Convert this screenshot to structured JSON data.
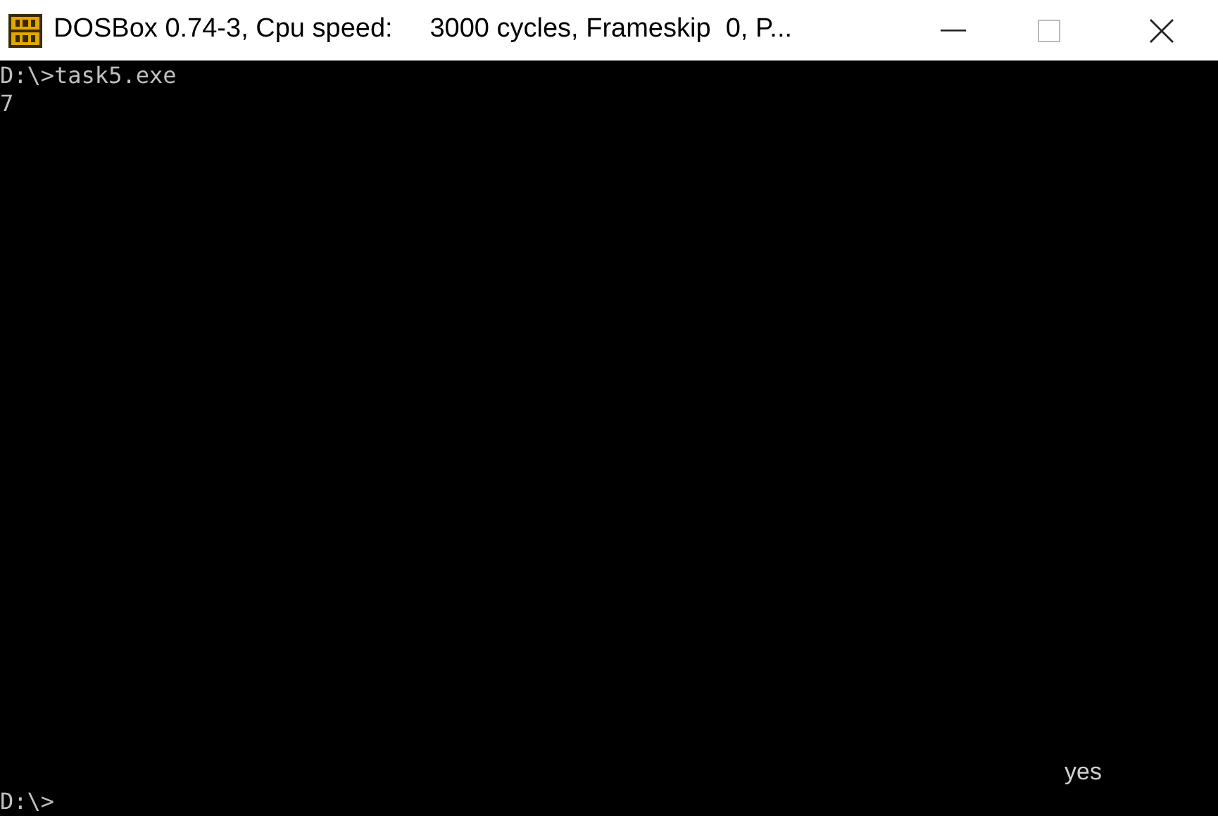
{
  "window": {
    "title": "DOSBox 0.74-3, Cpu speed:     3000 cycles, Frameskip  0, P..."
  },
  "console": {
    "lines": [
      "D:\\>task5.exe",
      "7"
    ],
    "output_note": "yes",
    "prompt": "D:\\>"
  }
}
